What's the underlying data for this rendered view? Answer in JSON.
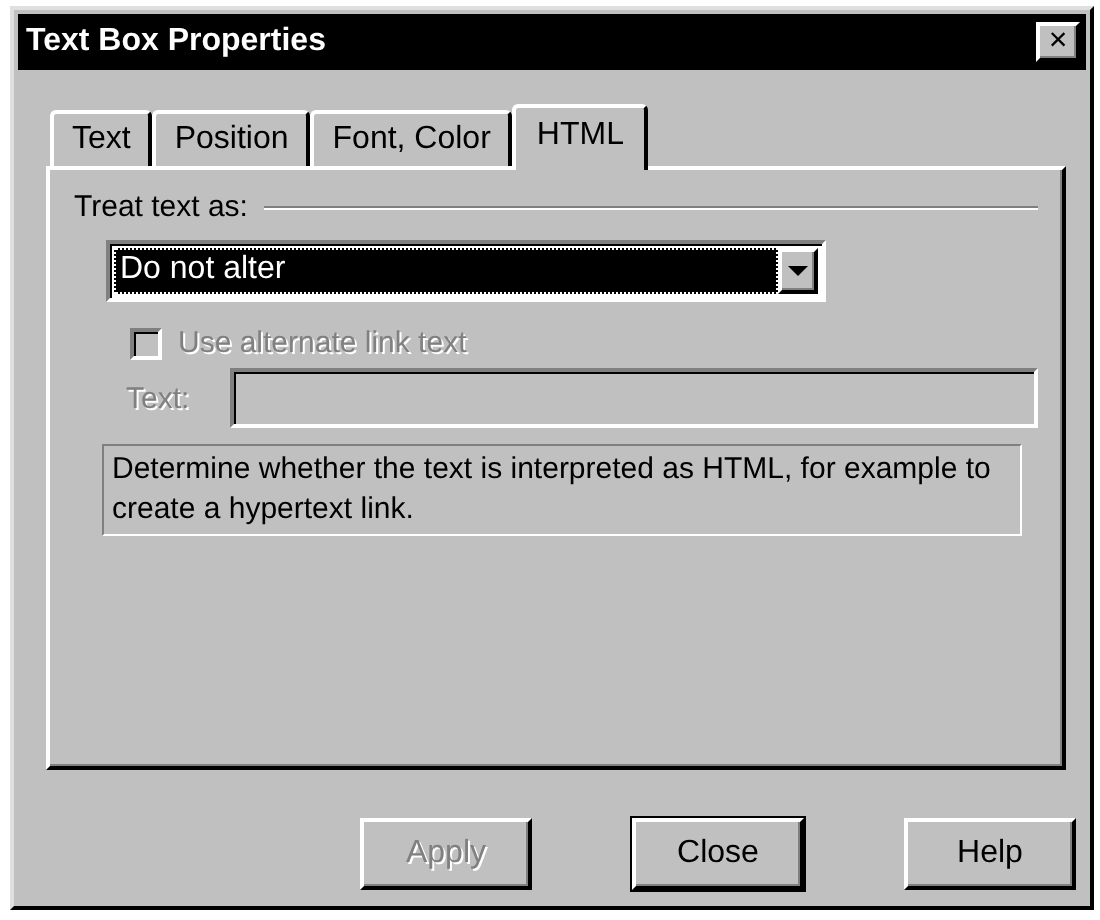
{
  "window": {
    "title": "Text Box Properties",
    "close_glyph": "×"
  },
  "tabs": [
    {
      "label": "Text",
      "selected": false
    },
    {
      "label": "Position",
      "selected": false
    },
    {
      "label": "Font, Color",
      "selected": false
    },
    {
      "label": "HTML",
      "selected": true
    }
  ],
  "group": {
    "label": "Treat text as:"
  },
  "treat_as": {
    "value": "Do not alter",
    "focused": true
  },
  "alternate_link": {
    "label": "Use alternate link text",
    "checked": false,
    "disabled": true
  },
  "text_field": {
    "label": "Text:",
    "disabled": true
  },
  "description": "Determine whether the text is interpreted as HTML, for example to create a hypertext link.",
  "buttons": [
    {
      "label": "Apply",
      "disabled": true,
      "default": false
    },
    {
      "label": "Close",
      "disabled": false,
      "default": true
    },
    {
      "label": "Help",
      "disabled": false,
      "default": false
    }
  ]
}
